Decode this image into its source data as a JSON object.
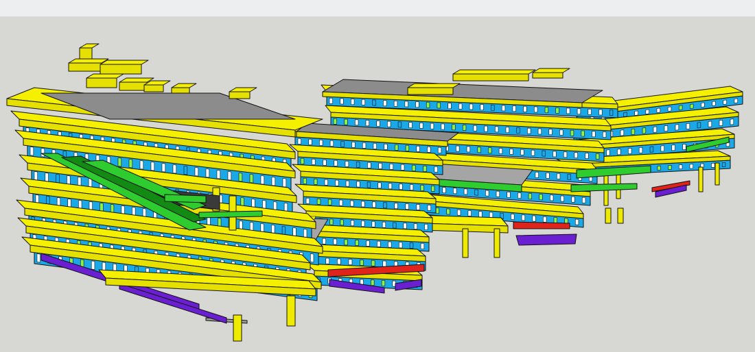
{
  "view": {
    "title": "",
    "top_strip_color": "#eceeef",
    "background_color": "#d7d7d3",
    "edge_color": "#111111"
  },
  "palette": {
    "slab_top": "#f4f000",
    "slab_front": "#e6e000",
    "slab_side": "#c9c300",
    "column": "#eeea00",
    "glass": "#1aa8e6",
    "window_white": "#ffffff",
    "green": "#2ecc2e",
    "green_light": "#8ef04a",
    "dark_green": "#138a13",
    "purple": "#6a1fd0",
    "red": "#e0241c",
    "roof_gray": "#8c8c8c",
    "terrace_gray": "#a5a5a5",
    "interior_dark": "#3a3a3a"
  },
  "scene_parts": [
    "left-building-block",
    "center-building-block",
    "right-building-cluster",
    "far-right-building-wing",
    "green-ramp",
    "support-columns",
    "rooftop-boxes"
  ]
}
